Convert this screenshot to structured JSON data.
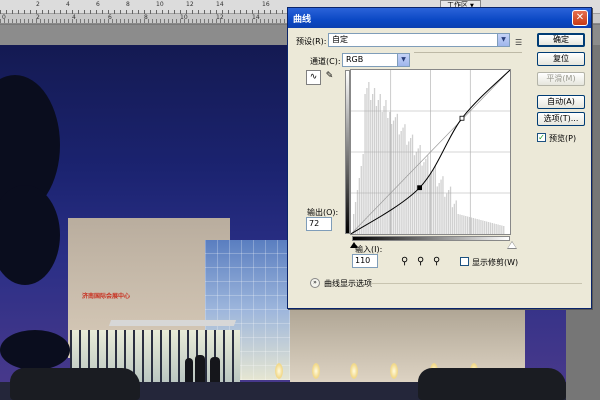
{
  "workspace": {
    "ruler_numbers": [
      "2",
      "4",
      "6",
      "8",
      "10",
      "12",
      "14",
      "16"
    ],
    "doc_ruler_numbers": [
      "0",
      "2",
      "4",
      "6",
      "8",
      "10",
      "12",
      "14"
    ],
    "workspace_button": "工作区",
    "canvas_sign_text": "济南国际会展中心"
  },
  "dialog": {
    "title": "曲线",
    "close": "✕",
    "preset_label": "预设(R):",
    "preset_value": "自定",
    "channel_label": "通道(C):",
    "channel_value": "RGB",
    "output_label": "输出(O):",
    "output_value": "72",
    "input_label": "输入(I):",
    "input_value": "110",
    "show_clipping_label": "显示修剪(W)",
    "show_clipping_checked": false,
    "curve_display_options_label": "曲线显示选项",
    "buttons": {
      "ok": "确定",
      "reset": "复位",
      "smooth": "平滑(M)",
      "auto": "自动(A)",
      "options": "选项(T)...",
      "preview_label": "预览(P)",
      "preview_checked": true
    },
    "curve_points": [
      {
        "input": 0,
        "output": 0
      },
      {
        "input": 110,
        "output": 72
      },
      {
        "input": 178,
        "output": 180
      },
      {
        "input": 255,
        "output": 255
      }
    ]
  }
}
